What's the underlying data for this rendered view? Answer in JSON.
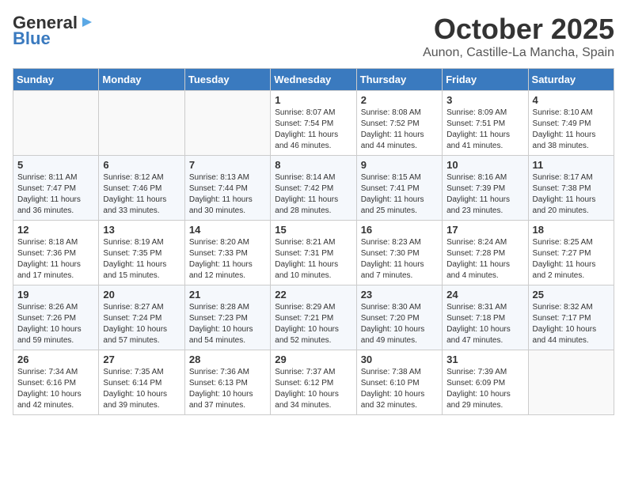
{
  "header": {
    "logo_general": "General",
    "logo_blue": "Blue",
    "month": "October 2025",
    "location": "Aunon, Castille-La Mancha, Spain"
  },
  "days_of_week": [
    "Sunday",
    "Monday",
    "Tuesday",
    "Wednesday",
    "Thursday",
    "Friday",
    "Saturday"
  ],
  "weeks": [
    [
      {
        "day": "",
        "info": ""
      },
      {
        "day": "",
        "info": ""
      },
      {
        "day": "",
        "info": ""
      },
      {
        "day": "1",
        "info": "Sunrise: 8:07 AM\nSunset: 7:54 PM\nDaylight: 11 hours\nand 46 minutes."
      },
      {
        "day": "2",
        "info": "Sunrise: 8:08 AM\nSunset: 7:52 PM\nDaylight: 11 hours\nand 44 minutes."
      },
      {
        "day": "3",
        "info": "Sunrise: 8:09 AM\nSunset: 7:51 PM\nDaylight: 11 hours\nand 41 minutes."
      },
      {
        "day": "4",
        "info": "Sunrise: 8:10 AM\nSunset: 7:49 PM\nDaylight: 11 hours\nand 38 minutes."
      }
    ],
    [
      {
        "day": "5",
        "info": "Sunrise: 8:11 AM\nSunset: 7:47 PM\nDaylight: 11 hours\nand 36 minutes."
      },
      {
        "day": "6",
        "info": "Sunrise: 8:12 AM\nSunset: 7:46 PM\nDaylight: 11 hours\nand 33 minutes."
      },
      {
        "day": "7",
        "info": "Sunrise: 8:13 AM\nSunset: 7:44 PM\nDaylight: 11 hours\nand 30 minutes."
      },
      {
        "day": "8",
        "info": "Sunrise: 8:14 AM\nSunset: 7:42 PM\nDaylight: 11 hours\nand 28 minutes."
      },
      {
        "day": "9",
        "info": "Sunrise: 8:15 AM\nSunset: 7:41 PM\nDaylight: 11 hours\nand 25 minutes."
      },
      {
        "day": "10",
        "info": "Sunrise: 8:16 AM\nSunset: 7:39 PM\nDaylight: 11 hours\nand 23 minutes."
      },
      {
        "day": "11",
        "info": "Sunrise: 8:17 AM\nSunset: 7:38 PM\nDaylight: 11 hours\nand 20 minutes."
      }
    ],
    [
      {
        "day": "12",
        "info": "Sunrise: 8:18 AM\nSunset: 7:36 PM\nDaylight: 11 hours\nand 17 minutes."
      },
      {
        "day": "13",
        "info": "Sunrise: 8:19 AM\nSunset: 7:35 PM\nDaylight: 11 hours\nand 15 minutes."
      },
      {
        "day": "14",
        "info": "Sunrise: 8:20 AM\nSunset: 7:33 PM\nDaylight: 11 hours\nand 12 minutes."
      },
      {
        "day": "15",
        "info": "Sunrise: 8:21 AM\nSunset: 7:31 PM\nDaylight: 11 hours\nand 10 minutes."
      },
      {
        "day": "16",
        "info": "Sunrise: 8:23 AM\nSunset: 7:30 PM\nDaylight: 11 hours\nand 7 minutes."
      },
      {
        "day": "17",
        "info": "Sunrise: 8:24 AM\nSunset: 7:28 PM\nDaylight: 11 hours\nand 4 minutes."
      },
      {
        "day": "18",
        "info": "Sunrise: 8:25 AM\nSunset: 7:27 PM\nDaylight: 11 hours\nand 2 minutes."
      }
    ],
    [
      {
        "day": "19",
        "info": "Sunrise: 8:26 AM\nSunset: 7:26 PM\nDaylight: 10 hours\nand 59 minutes."
      },
      {
        "day": "20",
        "info": "Sunrise: 8:27 AM\nSunset: 7:24 PM\nDaylight: 10 hours\nand 57 minutes."
      },
      {
        "day": "21",
        "info": "Sunrise: 8:28 AM\nSunset: 7:23 PM\nDaylight: 10 hours\nand 54 minutes."
      },
      {
        "day": "22",
        "info": "Sunrise: 8:29 AM\nSunset: 7:21 PM\nDaylight: 10 hours\nand 52 minutes."
      },
      {
        "day": "23",
        "info": "Sunrise: 8:30 AM\nSunset: 7:20 PM\nDaylight: 10 hours\nand 49 minutes."
      },
      {
        "day": "24",
        "info": "Sunrise: 8:31 AM\nSunset: 7:18 PM\nDaylight: 10 hours\nand 47 minutes."
      },
      {
        "day": "25",
        "info": "Sunrise: 8:32 AM\nSunset: 7:17 PM\nDaylight: 10 hours\nand 44 minutes."
      }
    ],
    [
      {
        "day": "26",
        "info": "Sunrise: 7:34 AM\nSunset: 6:16 PM\nDaylight: 10 hours\nand 42 minutes."
      },
      {
        "day": "27",
        "info": "Sunrise: 7:35 AM\nSunset: 6:14 PM\nDaylight: 10 hours\nand 39 minutes."
      },
      {
        "day": "28",
        "info": "Sunrise: 7:36 AM\nSunset: 6:13 PM\nDaylight: 10 hours\nand 37 minutes."
      },
      {
        "day": "29",
        "info": "Sunrise: 7:37 AM\nSunset: 6:12 PM\nDaylight: 10 hours\nand 34 minutes."
      },
      {
        "day": "30",
        "info": "Sunrise: 7:38 AM\nSunset: 6:10 PM\nDaylight: 10 hours\nand 32 minutes."
      },
      {
        "day": "31",
        "info": "Sunrise: 7:39 AM\nSunset: 6:09 PM\nDaylight: 10 hours\nand 29 minutes."
      },
      {
        "day": "",
        "info": ""
      }
    ]
  ]
}
